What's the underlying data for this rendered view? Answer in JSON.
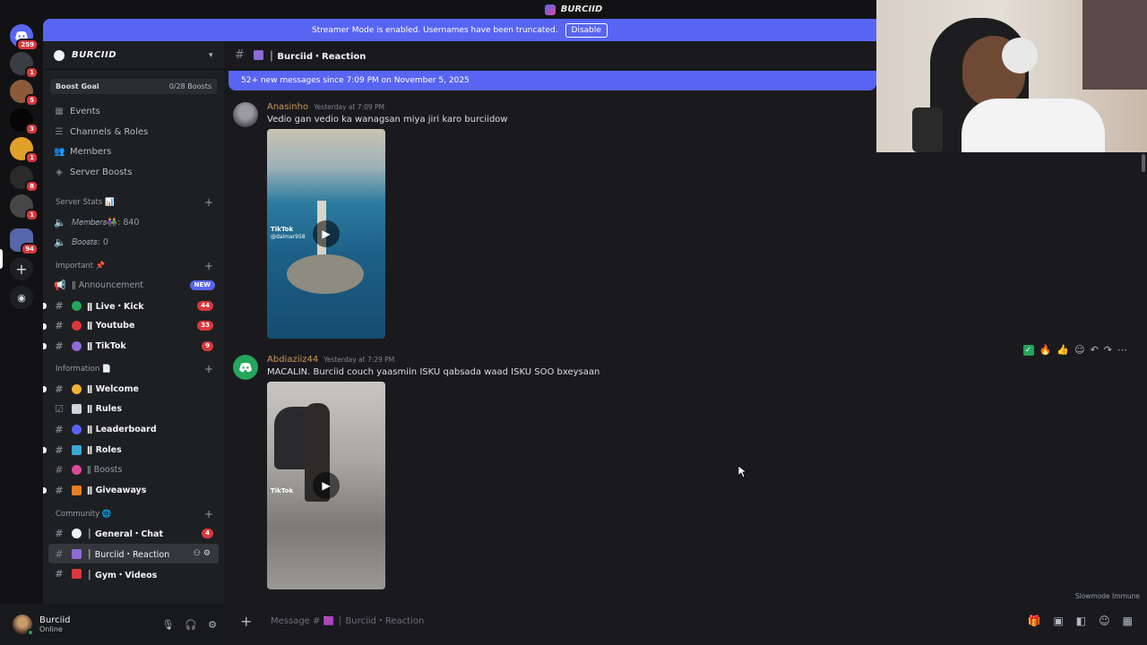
{
  "window": {
    "title": "BURCIID"
  },
  "banner": {
    "text": "Streamer Mode is enabled. Usernames have been truncated.",
    "button": "Disable"
  },
  "rail": {
    "badges": [
      "259",
      "1",
      "5",
      "3",
      "1",
      "8",
      "1",
      "94"
    ]
  },
  "server": {
    "name": "BURCIID",
    "boost_goal": "Boost Goal",
    "boost_count": "0/28 Boosts",
    "nav": [
      {
        "label": "Events",
        "icon": "calendar-icon"
      },
      {
        "label": "Channels & Roles",
        "icon": "list-icon"
      },
      {
        "label": "Members",
        "icon": "members-icon"
      },
      {
        "label": "Server Boosts",
        "icon": "boost-icon"
      }
    ]
  },
  "categories": {
    "stats": "Server Stats 📊",
    "important": "Important 📌",
    "information": "Information 📄",
    "community": "Community 🌐"
  },
  "channels": {
    "stats_members": "𝑀𝑒𝑚𝑏𝑒𝑟𝑠👫: 840",
    "stats_boosts": "𝐵𝑜𝑜𝑠𝑡𝑠: 0",
    "announcement": "ǁ Announcement",
    "announcement_badge": "NEW",
    "live": "ǁ Live・Kick",
    "live_badge": "44",
    "youtube": "ǁ Youtube",
    "youtube_badge": "33",
    "tiktok": "ǁ TikTok",
    "tiktok_badge": "9",
    "welcome": "ǁ Welcome",
    "rules": "ǁ Rules",
    "leaderboard": "ǁ Leaderboard",
    "roles": "ǁ Roles",
    "boosts": "ǁ Boosts",
    "giveaways": "ǁ Giveaways",
    "general": "│ General・Chat",
    "general_badge": "4",
    "reaction": "│ Burciid・Reaction",
    "gym": "│ Gym・Videos"
  },
  "user": {
    "name": "Burciid",
    "status": "Online"
  },
  "channel_header": {
    "name": "│ Burciid・Reaction"
  },
  "new_messages": "52+ new messages since 7:09 PM on November 5, 2025",
  "messages": [
    {
      "author": "Anasinho",
      "time": "Yesterday at 7:09 PM",
      "text": "Vedio gan vedio ka wanagsan miya jiri karo burciidow",
      "video_label": "TikTok",
      "video_handle": "@dalmar958"
    },
    {
      "author": "Abdiaziiz44",
      "time": "Yesterday at 7:29 PM",
      "text": "MACALIN. Burciid couch yaasmiin ISKU qabsada waad ISKU SOO bxeysaan",
      "video_label": "TikTok"
    }
  ],
  "slowmode": "Slowmode Immune",
  "composer": {
    "placeholder": "Message # 🟪 │ Burciid・Reaction"
  },
  "colors": {
    "accent": "#5865f2",
    "badge": "#da373c",
    "online": "#23a55a",
    "author": "#c99a5b"
  }
}
